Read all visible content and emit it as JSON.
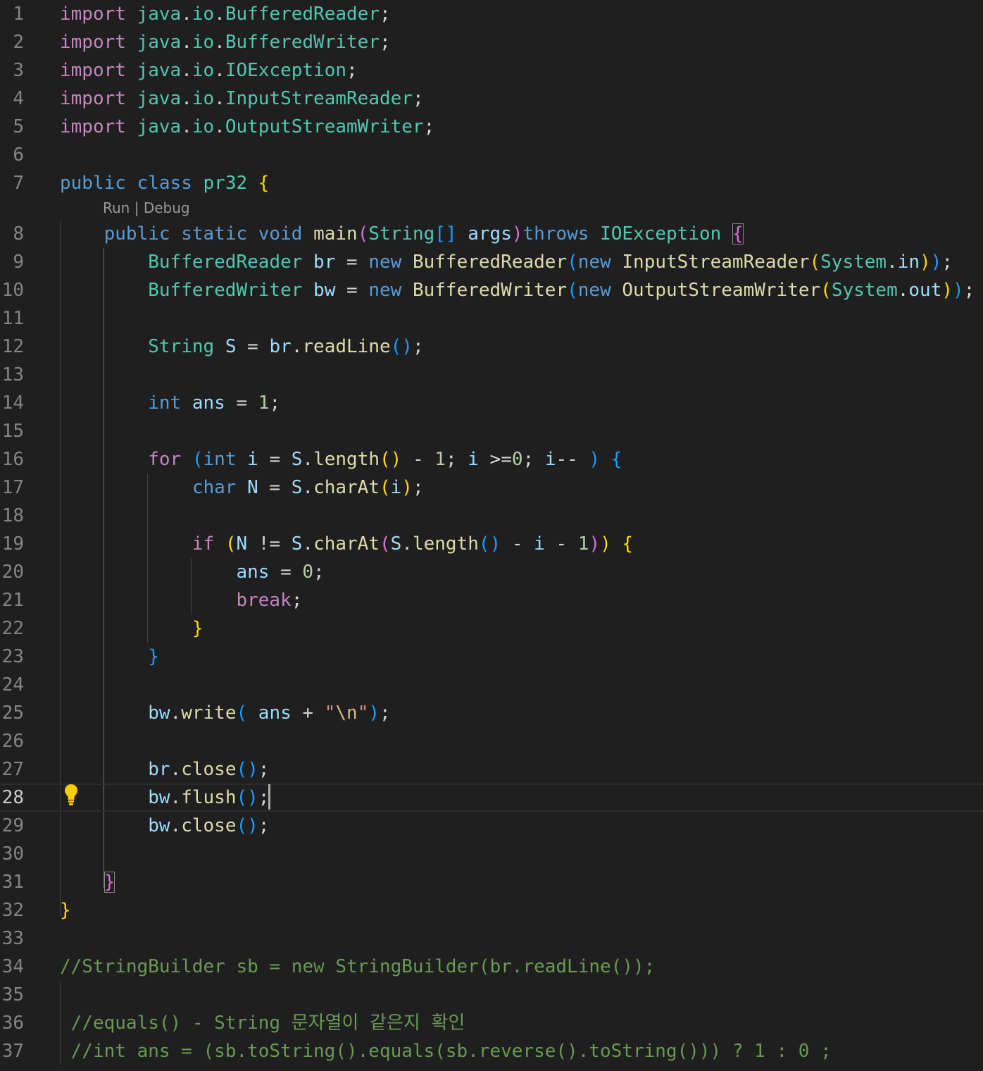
{
  "editor": {
    "language": "java",
    "class_name": "pr32",
    "current_line": 28,
    "codelens": {
      "run": "Run",
      "separator": " | ",
      "debug": "Debug"
    },
    "lightbulb_icon": "lightbulb-icon",
    "colors": {
      "background": "#1f1f1f",
      "keyword": "#569cd6",
      "control_keyword": "#c586c0",
      "type": "#4ec9b0",
      "function": "#dcdcaa",
      "variable": "#9cdcfe",
      "number": "#b5cea8",
      "string": "#ce9178",
      "comment": "#6a9955",
      "line_number": "#858585"
    },
    "lines": [
      {
        "n": "1",
        "tokens": [
          [
            "kc",
            "import"
          ],
          [
            "pc",
            " "
          ],
          [
            "ty",
            "java"
          ],
          [
            "pc",
            "."
          ],
          [
            "ty",
            "io"
          ],
          [
            "pc",
            "."
          ],
          [
            "ty",
            "BufferedReader"
          ],
          [
            "pc",
            ";"
          ]
        ]
      },
      {
        "n": "2",
        "tokens": [
          [
            "kc",
            "import"
          ],
          [
            "pc",
            " "
          ],
          [
            "ty",
            "java"
          ],
          [
            "pc",
            "."
          ],
          [
            "ty",
            "io"
          ],
          [
            "pc",
            "."
          ],
          [
            "ty",
            "BufferedWriter"
          ],
          [
            "pc",
            ";"
          ]
        ]
      },
      {
        "n": "3",
        "tokens": [
          [
            "kc",
            "import"
          ],
          [
            "pc",
            " "
          ],
          [
            "ty",
            "java"
          ],
          [
            "pc",
            "."
          ],
          [
            "ty",
            "io"
          ],
          [
            "pc",
            "."
          ],
          [
            "ty",
            "IOException"
          ],
          [
            "pc",
            ";"
          ]
        ]
      },
      {
        "n": "4",
        "tokens": [
          [
            "kc",
            "import"
          ],
          [
            "pc",
            " "
          ],
          [
            "ty",
            "java"
          ],
          [
            "pc",
            "."
          ],
          [
            "ty",
            "io"
          ],
          [
            "pc",
            "."
          ],
          [
            "ty",
            "InputStreamReader"
          ],
          [
            "pc",
            ";"
          ]
        ]
      },
      {
        "n": "5",
        "tokens": [
          [
            "kc",
            "import"
          ],
          [
            "pc",
            " "
          ],
          [
            "ty",
            "java"
          ],
          [
            "pc",
            "."
          ],
          [
            "ty",
            "io"
          ],
          [
            "pc",
            "."
          ],
          [
            "ty",
            "OutputStreamWriter"
          ],
          [
            "pc",
            ";"
          ]
        ]
      },
      {
        "n": "6",
        "tokens": []
      },
      {
        "n": "7",
        "tokens": [
          [
            "kw",
            "public"
          ],
          [
            "pc",
            " "
          ],
          [
            "kw",
            "class"
          ],
          [
            "pc",
            " "
          ],
          [
            "ty",
            "pr32"
          ],
          [
            "pc",
            " "
          ],
          [
            "b1",
            "{"
          ]
        ]
      },
      {
        "n": "8",
        "tokens": [
          [
            "pc",
            "    "
          ],
          [
            "kw",
            "public"
          ],
          [
            "pc",
            " "
          ],
          [
            "kw",
            "static"
          ],
          [
            "pc",
            " "
          ],
          [
            "kw",
            "void"
          ],
          [
            "pc",
            " "
          ],
          [
            "fn",
            "main"
          ],
          [
            "b2",
            "("
          ],
          [
            "ty",
            "String"
          ],
          [
            "b3",
            "[]"
          ],
          [
            "pc",
            " "
          ],
          [
            "va",
            "args"
          ],
          [
            "b2",
            ")"
          ],
          [
            "kw",
            "throws"
          ],
          [
            "pc",
            " "
          ],
          [
            "ty",
            "IOException"
          ],
          [
            "pc",
            " "
          ],
          [
            "b2 bbox",
            "{"
          ]
        ]
      },
      {
        "n": "9",
        "tokens": [
          [
            "pc",
            "        "
          ],
          [
            "ty",
            "BufferedReader"
          ],
          [
            "pc",
            " "
          ],
          [
            "va",
            "br"
          ],
          [
            "pc",
            " = "
          ],
          [
            "kw",
            "new"
          ],
          [
            "pc",
            " "
          ],
          [
            "fn",
            "BufferedReader"
          ],
          [
            "b3",
            "("
          ],
          [
            "kw",
            "new"
          ],
          [
            "pc",
            " "
          ],
          [
            "fn",
            "InputStreamReader"
          ],
          [
            "b1",
            "("
          ],
          [
            "ty",
            "System"
          ],
          [
            "pc",
            "."
          ],
          [
            "va",
            "in"
          ],
          [
            "b1",
            ")"
          ],
          [
            "b3",
            ")"
          ],
          [
            "pc",
            ";"
          ]
        ]
      },
      {
        "n": "10",
        "tokens": [
          [
            "pc",
            "        "
          ],
          [
            "ty",
            "BufferedWriter"
          ],
          [
            "pc",
            " "
          ],
          [
            "va",
            "bw"
          ],
          [
            "pc",
            " = "
          ],
          [
            "kw",
            "new"
          ],
          [
            "pc",
            " "
          ],
          [
            "fn",
            "BufferedWriter"
          ],
          [
            "b3",
            "("
          ],
          [
            "kw",
            "new"
          ],
          [
            "pc",
            " "
          ],
          [
            "fn",
            "OutputStreamWriter"
          ],
          [
            "b1",
            "("
          ],
          [
            "ty",
            "System"
          ],
          [
            "pc",
            "."
          ],
          [
            "va",
            "out"
          ],
          [
            "b1",
            ")"
          ],
          [
            "b3",
            ")"
          ],
          [
            "pc",
            ";"
          ]
        ]
      },
      {
        "n": "11",
        "tokens": []
      },
      {
        "n": "12",
        "tokens": [
          [
            "pc",
            "        "
          ],
          [
            "ty",
            "String"
          ],
          [
            "pc",
            " "
          ],
          [
            "va",
            "S"
          ],
          [
            "pc",
            " = "
          ],
          [
            "va",
            "br"
          ],
          [
            "pc",
            "."
          ],
          [
            "fn",
            "readLine"
          ],
          [
            "b3",
            "()"
          ],
          [
            "pc",
            ";"
          ]
        ]
      },
      {
        "n": "13",
        "tokens": []
      },
      {
        "n": "14",
        "tokens": [
          [
            "pc",
            "        "
          ],
          [
            "kw",
            "int"
          ],
          [
            "pc",
            " "
          ],
          [
            "va",
            "ans"
          ],
          [
            "pc",
            " = "
          ],
          [
            "nu",
            "1"
          ],
          [
            "pc",
            ";"
          ]
        ]
      },
      {
        "n": "15",
        "tokens": []
      },
      {
        "n": "16",
        "tokens": [
          [
            "pc",
            "        "
          ],
          [
            "kc",
            "for"
          ],
          [
            "pc",
            " "
          ],
          [
            "b3",
            "("
          ],
          [
            "kw",
            "int"
          ],
          [
            "pc",
            " "
          ],
          [
            "va",
            "i"
          ],
          [
            "pc",
            " = "
          ],
          [
            "va",
            "S"
          ],
          [
            "pc",
            "."
          ],
          [
            "fn",
            "length"
          ],
          [
            "b1",
            "()"
          ],
          [
            "pc",
            " - "
          ],
          [
            "nu",
            "1"
          ],
          [
            "pc",
            "; "
          ],
          [
            "va",
            "i"
          ],
          [
            "pc",
            " >="
          ],
          [
            "nu",
            "0"
          ],
          [
            "pc",
            "; "
          ],
          [
            "va",
            "i"
          ],
          [
            "pc",
            "-- "
          ],
          [
            "b3",
            ")"
          ],
          [
            "pc",
            " "
          ],
          [
            "b3",
            "{"
          ]
        ]
      },
      {
        "n": "17",
        "tokens": [
          [
            "pc",
            "            "
          ],
          [
            "kw",
            "char"
          ],
          [
            "pc",
            " "
          ],
          [
            "va",
            "N"
          ],
          [
            "pc",
            " = "
          ],
          [
            "va",
            "S"
          ],
          [
            "pc",
            "."
          ],
          [
            "fn",
            "charAt"
          ],
          [
            "b1",
            "("
          ],
          [
            "va",
            "i"
          ],
          [
            "b1",
            ")"
          ],
          [
            "pc",
            ";"
          ]
        ]
      },
      {
        "n": "18",
        "tokens": []
      },
      {
        "n": "19",
        "tokens": [
          [
            "pc",
            "            "
          ],
          [
            "kc",
            "if"
          ],
          [
            "pc",
            " "
          ],
          [
            "b1",
            "("
          ],
          [
            "va",
            "N"
          ],
          [
            "pc",
            " != "
          ],
          [
            "va",
            "S"
          ],
          [
            "pc",
            "."
          ],
          [
            "fn",
            "charAt"
          ],
          [
            "b2",
            "("
          ],
          [
            "va",
            "S"
          ],
          [
            "pc",
            "."
          ],
          [
            "fn",
            "length"
          ],
          [
            "b3",
            "()"
          ],
          [
            "pc",
            " - "
          ],
          [
            "va",
            "i"
          ],
          [
            "pc",
            " - "
          ],
          [
            "nu",
            "1"
          ],
          [
            "b2",
            ")"
          ],
          [
            "b1",
            ")"
          ],
          [
            "pc",
            " "
          ],
          [
            "b1",
            "{"
          ]
        ]
      },
      {
        "n": "20",
        "tokens": [
          [
            "pc",
            "                "
          ],
          [
            "va",
            "ans"
          ],
          [
            "pc",
            " = "
          ],
          [
            "nu",
            "0"
          ],
          [
            "pc",
            ";"
          ]
        ]
      },
      {
        "n": "21",
        "tokens": [
          [
            "pc",
            "                "
          ],
          [
            "kc",
            "break"
          ],
          [
            "pc",
            ";"
          ]
        ]
      },
      {
        "n": "22",
        "tokens": [
          [
            "pc",
            "            "
          ],
          [
            "b1",
            "}"
          ]
        ]
      },
      {
        "n": "23",
        "tokens": [
          [
            "pc",
            "        "
          ],
          [
            "b3",
            "}"
          ]
        ]
      },
      {
        "n": "24",
        "tokens": []
      },
      {
        "n": "25",
        "tokens": [
          [
            "pc",
            "        "
          ],
          [
            "va",
            "bw"
          ],
          [
            "pc",
            "."
          ],
          [
            "fn",
            "write"
          ],
          [
            "b3",
            "("
          ],
          [
            "pc",
            " "
          ],
          [
            "va",
            "ans"
          ],
          [
            "pc",
            " + "
          ],
          [
            "st",
            "\""
          ],
          [
            "es",
            "\\n"
          ],
          [
            "st",
            "\""
          ],
          [
            "b3",
            ")"
          ],
          [
            "pc",
            ";"
          ]
        ]
      },
      {
        "n": "26",
        "tokens": []
      },
      {
        "n": "27",
        "tokens": [
          [
            "pc",
            "        "
          ],
          [
            "va",
            "br"
          ],
          [
            "pc",
            "."
          ],
          [
            "fn",
            "close"
          ],
          [
            "b3",
            "()"
          ],
          [
            "pc",
            ";"
          ]
        ]
      },
      {
        "n": "28",
        "tokens": [
          [
            "pc",
            "        "
          ],
          [
            "va",
            "bw"
          ],
          [
            "pc",
            "."
          ],
          [
            "fn",
            "flush"
          ],
          [
            "b3",
            "()"
          ],
          [
            "pc",
            ";"
          ]
        ]
      },
      {
        "n": "29",
        "tokens": [
          [
            "pc",
            "        "
          ],
          [
            "va",
            "bw"
          ],
          [
            "pc",
            "."
          ],
          [
            "fn",
            "close"
          ],
          [
            "b3",
            "()"
          ],
          [
            "pc",
            ";"
          ]
        ]
      },
      {
        "n": "30",
        "tokens": []
      },
      {
        "n": "31",
        "tokens": [
          [
            "pc",
            "    "
          ],
          [
            "b2 bbox",
            "}"
          ]
        ]
      },
      {
        "n": "32",
        "tokens": [
          [
            "b1",
            "}"
          ]
        ]
      },
      {
        "n": "33",
        "tokens": []
      },
      {
        "n": "34",
        "tokens": [
          [
            "cm",
            "//StringBuilder sb = new StringBuilder(br.readLine());"
          ]
        ]
      },
      {
        "n": "35",
        "tokens": []
      },
      {
        "n": "36",
        "tokens": [
          [
            "cm",
            " //equals() - String 문자열이 같은지 확인"
          ]
        ]
      },
      {
        "n": "37",
        "tokens": [
          [
            "cm",
            " //int ans = (sb.toString().equals(sb.reverse().toString())) ? 1 : 0 ;"
          ]
        ]
      }
    ]
  }
}
